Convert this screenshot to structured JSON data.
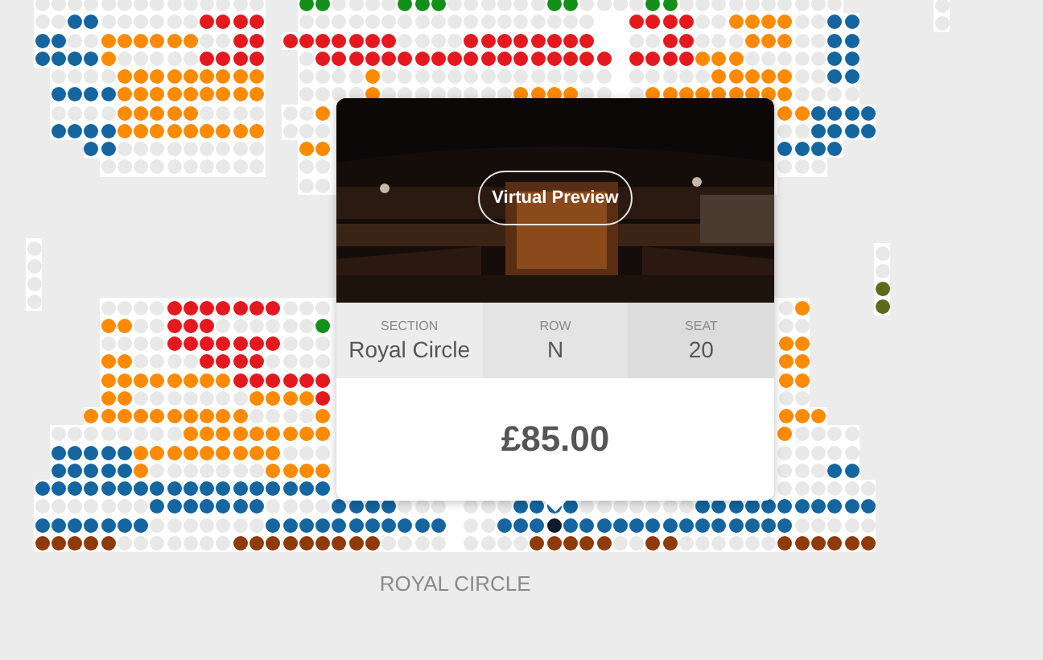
{
  "section_label": "ROYAL CIRCLE",
  "seat_popup": {
    "button": "Virtual Preview",
    "details": [
      {
        "label": "SECTION",
        "value": "Royal Circle"
      },
      {
        "label": "ROW",
        "value": "N"
      },
      {
        "label": "SEAT",
        "value": "20"
      }
    ],
    "price": "£85.00"
  }
}
